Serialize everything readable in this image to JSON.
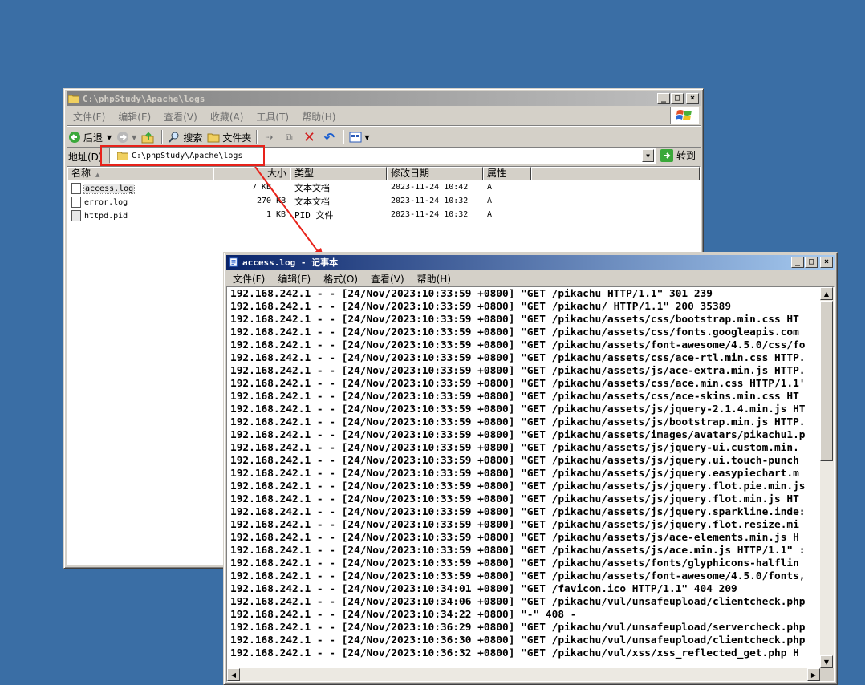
{
  "explorer": {
    "title": "C:\\phpStudy\\Apache\\logs",
    "menu": [
      "文件(F)",
      "编辑(E)",
      "查看(V)",
      "收藏(A)",
      "工具(T)",
      "帮助(H)"
    ],
    "toolbar": {
      "back": "后退",
      "search": "搜索",
      "folders": "文件夹"
    },
    "address_label": "地址(D)",
    "address_value": "C:\\phpStudy\\Apache\\logs",
    "go_label": "转到",
    "columns": [
      "名称",
      "大小",
      "类型",
      "修改日期",
      "属性"
    ],
    "files": [
      {
        "name": "access.log",
        "size": "7 KB",
        "type": "文本文档",
        "modified": "2023-11-24 10:42",
        "attr": "A"
      },
      {
        "name": "error.log",
        "size": "270 KB",
        "type": "文本文档",
        "modified": "2023-11-24 10:32",
        "attr": "A"
      },
      {
        "name": "httpd.pid",
        "size": "1 KB",
        "type": "PID 文件",
        "modified": "2023-11-24 10:32",
        "attr": "A"
      }
    ]
  },
  "notepad": {
    "title": "access.log - 记事本",
    "menu": [
      "文件(F)",
      "编辑(E)",
      "格式(O)",
      "查看(V)",
      "帮助(H)"
    ],
    "lines": [
      "192.168.242.1 - - [24/Nov/2023:10:33:59 +0800] \"GET /pikachu HTTP/1.1\" 301 239",
      "192.168.242.1 - - [24/Nov/2023:10:33:59 +0800] \"GET /pikachu/ HTTP/1.1\" 200 35389",
      "192.168.242.1 - - [24/Nov/2023:10:33:59 +0800] \"GET /pikachu/assets/css/bootstrap.min.css HT",
      "192.168.242.1 - - [24/Nov/2023:10:33:59 +0800] \"GET /pikachu/assets/css/fonts.googleapis.com",
      "192.168.242.1 - - [24/Nov/2023:10:33:59 +0800] \"GET /pikachu/assets/font-awesome/4.5.0/css/fo",
      "192.168.242.1 - - [24/Nov/2023:10:33:59 +0800] \"GET /pikachu/assets/css/ace-rtl.min.css HTTP.",
      "192.168.242.1 - - [24/Nov/2023:10:33:59 +0800] \"GET /pikachu/assets/js/ace-extra.min.js HTTP.",
      "192.168.242.1 - - [24/Nov/2023:10:33:59 +0800] \"GET /pikachu/assets/css/ace.min.css HTTP/1.1'",
      "192.168.242.1 - - [24/Nov/2023:10:33:59 +0800] \"GET /pikachu/assets/css/ace-skins.min.css HT",
      "192.168.242.1 - - [24/Nov/2023:10:33:59 +0800] \"GET /pikachu/assets/js/jquery-2.1.4.min.js HT",
      "192.168.242.1 - - [24/Nov/2023:10:33:59 +0800] \"GET /pikachu/assets/js/bootstrap.min.js HTTP.",
      "192.168.242.1 - - [24/Nov/2023:10:33:59 +0800] \"GET /pikachu/assets/images/avatars/pikachu1.p",
      "192.168.242.1 - - [24/Nov/2023:10:33:59 +0800] \"GET /pikachu/assets/js/jquery-ui.custom.min.",
      "192.168.242.1 - - [24/Nov/2023:10:33:59 +0800] \"GET /pikachu/assets/js/jquery.ui.touch-punch",
      "192.168.242.1 - - [24/Nov/2023:10:33:59 +0800] \"GET /pikachu/assets/js/jquery.easypiechart.m",
      "192.168.242.1 - - [24/Nov/2023:10:33:59 +0800] \"GET /pikachu/assets/js/jquery.flot.pie.min.js",
      "192.168.242.1 - - [24/Nov/2023:10:33:59 +0800] \"GET /pikachu/assets/js/jquery.flot.min.js HT",
      "192.168.242.1 - - [24/Nov/2023:10:33:59 +0800] \"GET /pikachu/assets/js/jquery.sparkline.inde:",
      "192.168.242.1 - - [24/Nov/2023:10:33:59 +0800] \"GET /pikachu/assets/js/jquery.flot.resize.mi",
      "192.168.242.1 - - [24/Nov/2023:10:33:59 +0800] \"GET /pikachu/assets/js/ace-elements.min.js H",
      "192.168.242.1 - - [24/Nov/2023:10:33:59 +0800] \"GET /pikachu/assets/js/ace.min.js HTTP/1.1\" :",
      "192.168.242.1 - - [24/Nov/2023:10:33:59 +0800] \"GET /pikachu/assets/fonts/glyphicons-halflin",
      "192.168.242.1 - - [24/Nov/2023:10:33:59 +0800] \"GET /pikachu/assets/font-awesome/4.5.0/fonts,",
      "192.168.242.1 - - [24/Nov/2023:10:34:01 +0800] \"GET /favicon.ico HTTP/1.1\" 404 209",
      "192.168.242.1 - - [24/Nov/2023:10:34:06 +0800] \"GET /pikachu/vul/unsafeupload/clientcheck.php",
      "192.168.242.1 - - [24/Nov/2023:10:34:22 +0800] \"-\" 408 -",
      "192.168.242.1 - - [24/Nov/2023:10:36:29 +0800] \"GET /pikachu/vul/unsafeupload/servercheck.php",
      "192.168.242.1 - - [24/Nov/2023:10:36:30 +0800] \"GET /pikachu/vul/unsafeupload/clientcheck.php",
      "192.168.242.1 - - [24/Nov/2023:10:36:32 +0800] \"GET /pikachu/vul/xss/xss_reflected_get.php H"
    ]
  },
  "colors": {
    "desktop": "#3a6ea5",
    "annotation": "#e8221a"
  }
}
